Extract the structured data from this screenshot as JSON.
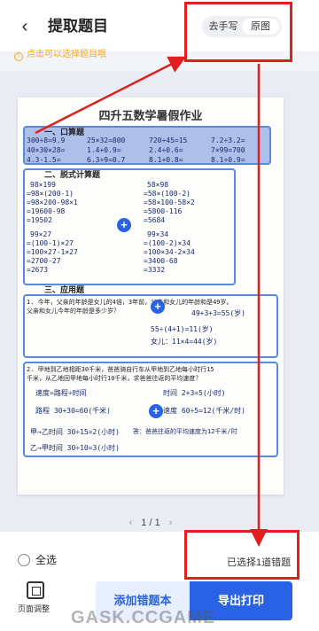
{
  "header": {
    "back_icon": "chevron-left-icon",
    "title": "提取题目",
    "toggle": {
      "options": [
        "去手写",
        "原图"
      ],
      "selected": "原图"
    }
  },
  "hint": {
    "icon": "info-icon",
    "text": "点击可以选择题目哦"
  },
  "worksheet": {
    "title": "四升五数学暑假作业",
    "sections": [
      {
        "title": "一、口算题",
        "lines": [
          "300÷8=9.9",
          "25×32=800",
          "720÷45=15",
          "7.2÷3.2=",
          "40×30×28=",
          "1.4+0.9=",
          "2.4÷0.6=",
          "7×99=700",
          "4.3-1.5=",
          "6.3÷9=0.7",
          "8.1+0.8=",
          "8.1÷0.9="
        ]
      },
      {
        "title": "二、脱式计算题",
        "lines": [
          "98×199",
          "=98×(200-1)",
          "=98×200-98×1",
          "=19600-98",
          "=19502",
          "58×98",
          "=58×(100-2)",
          "=58×100-58×2",
          "=5800-116",
          "=5684",
          "99×27",
          "=(100-1)×27",
          "=100×27-1×27",
          "=2700-27",
          "=2673",
          "99×34",
          "=(100-2)×34",
          "=100×34-2×34",
          "=3400-68",
          "=3332"
        ]
      },
      {
        "title": "三、应用题",
        "lines": [
          "1. 今年，父亲的年龄是女儿的4倍，3年前，父亲和女儿的年龄和是49岁。",
          "父亲和女儿今年的年龄是多少岁？",
          "49+3+3=55(岁)",
          "55÷(4+1)=11(岁)",
          "女儿：11×4=44(岁)"
        ]
      },
      {
        "title": "",
        "lines": [
          "2. 甲地到乙地相距30千米，爸爸骑自行车从甲地到乙地每小时行15",
          "千米，从乙地回甲地每小时行10千米，求爸爸往返的平均速度？",
          "速度=路程÷时间",
          "路程 30+30=60(千米)",
          "甲→乙时间 30÷15=2(小时)",
          "乙→甲时间 30÷10=3(小时)",
          "时间 2+3=5(小时)",
          "速度 60÷5=12(千米/时)",
          "答：爸爸往返的平均速度为12千米/时"
        ]
      }
    ],
    "add_icons": [
      "plus-icon",
      "plus-icon",
      "plus-icon"
    ]
  },
  "pager": {
    "prev_icon": "chevron-left-icon",
    "text": "1 / 1",
    "next_icon": "chevron-right-icon"
  },
  "bottom_bar": {
    "select_all": "全选",
    "selected_text": "已选择1道错题",
    "adjust_label": "页面调整",
    "add_button": "添加错题本",
    "export_button": "导出打印"
  },
  "watermark": "GASK.CCGAME",
  "colors": {
    "accent": "#2a62e6",
    "annotation": "#e02020",
    "hint": "#f5a623",
    "selection": "#5a8ad8"
  }
}
